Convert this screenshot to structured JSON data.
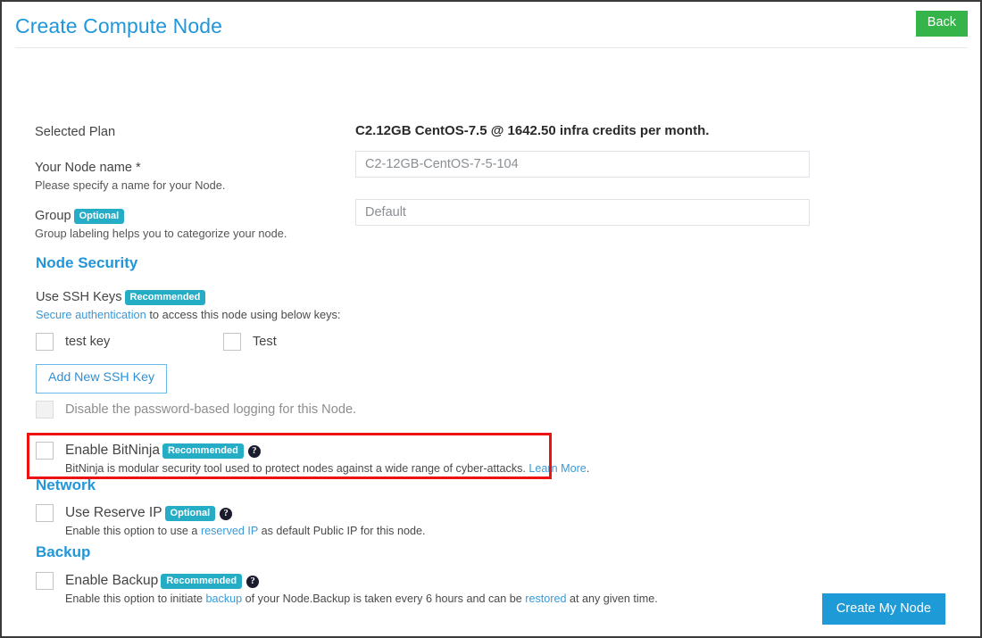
{
  "window": {
    "title": "Create Compute Node"
  },
  "header": {
    "title": "Create Compute Node",
    "back_label": "Back",
    "back_color": "#35b449",
    "title_color": "#2196d9"
  },
  "form": {
    "selected_plan": {
      "label": "Selected Plan",
      "value": "C2.12GB CentOS-7.5 @ 1642.50 infra credits per month."
    },
    "node_name": {
      "label": "Your Node name *",
      "help": "Please specify a name for your Node.",
      "value": "C2-12GB-CentOS-7-5-104",
      "placeholder": "C2-12GB-CentOS-7-5-104"
    },
    "group": {
      "label": "Group",
      "badge": "Optional",
      "help": "Group labeling helps you to categorize your node.",
      "value": "Default",
      "placeholder": "Default"
    }
  },
  "node_security": {
    "heading": "Node Security",
    "ssh": {
      "label": "Use SSH Keys",
      "badge": "Recommended",
      "desc_link": "Secure authentication",
      "desc_rest": " to access this node using below keys:",
      "keys": [
        {
          "label": "test key",
          "checked": false
        },
        {
          "label": "Test",
          "checked": false
        }
      ],
      "add_key_label": "Add New SSH Key"
    },
    "disable_password": {
      "label": "Disable the password-based logging for this Node.",
      "checked": false,
      "disabled": true
    },
    "bitninja": {
      "label": "Enable BitNinja",
      "badge": "Recommended",
      "help_icon": "question-circle-icon",
      "desc": "BitNinja is modular security tool used to protect nodes against a wide range of cyber-attacks. ",
      "desc_link": "Learn More",
      "desc_end": ".",
      "checked": false,
      "highlight_color": "#ee1111"
    }
  },
  "network": {
    "heading": "Network",
    "reserve_ip": {
      "label": "Use Reserve IP",
      "badge": "Optional",
      "help_icon": "question-circle-icon",
      "desc_start": "Enable this option to use a ",
      "desc_link": "reserved IP",
      "desc_end": " as default Public IP for this node.",
      "checked": false
    }
  },
  "backup": {
    "heading": "Backup",
    "enable_backup": {
      "label": "Enable Backup",
      "badge": "Recommended",
      "help_icon": "question-circle-icon",
      "desc_start": "Enable this option to initiate ",
      "desc_link1": "backup",
      "desc_mid": " of your Node.Backup is taken every 6 hours and can be ",
      "desc_link2": "restored",
      "desc_end": " at any given time.",
      "checked": false
    }
  },
  "footer": {
    "submit_label": "Create My Node",
    "submit_color": "#1e9ad6"
  },
  "theme": {
    "accent_blue": "#2196d9",
    "badge_teal": "#26adc6",
    "link_blue": "#3a9ad9",
    "green": "#35b449",
    "red_highlight": "#ee1111"
  }
}
